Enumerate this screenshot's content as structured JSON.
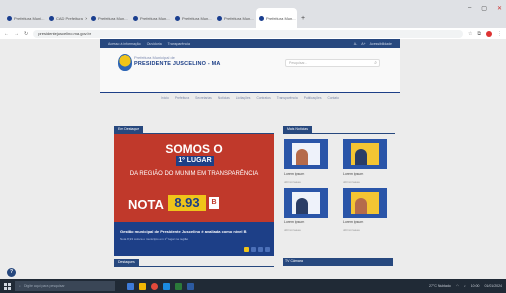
{
  "browser": {
    "tabs": [
      {
        "label": "Prefeitura Muni..."
      },
      {
        "label": "CAD Prefeitura"
      },
      {
        "label": "Prefeitura Mun..."
      },
      {
        "label": "Prefeitura Mun..."
      },
      {
        "label": "Prefeitura Mun..."
      },
      {
        "label": "Prefeitura Mun..."
      },
      {
        "label": "Prefeitura Mun..."
      }
    ],
    "new_tab": "+",
    "window_controls": {
      "minimize": "–",
      "maximize": "▢",
      "close": "✕"
    },
    "url": "presidentejuscelino.ma.gov.br",
    "back": "←",
    "forward": "→",
    "reload": "↻"
  },
  "site": {
    "topbar_left": [
      "Acesso à informação",
      "Ouvidoria",
      "Transparência"
    ],
    "topbar_right": [
      "A-",
      "A+",
      "Acessibilidade"
    ],
    "brand_top": "Prefeitura Municipal de",
    "brand_main": "PRESIDENTE JUSCELINO - MA",
    "search_placeholder": "Pesquisar...",
    "menu": [
      "Início",
      "Prefeitura",
      "Secretarias",
      "Notícias",
      "Licitações",
      "Contratos",
      "Transparência",
      "Publicações",
      "Contato"
    ]
  },
  "featured": {
    "section_title": "Em Destaque",
    "hero_line1": "SOMOS O",
    "hero_line2": "1º LUGAR",
    "hero_line3": "DA REGIÃO DO MUNIM EM TRANSPARÊNCIA",
    "nota_label": "NOTA",
    "nota_value": "8.93",
    "grade": "B",
    "caption_title": "Gestão municipal de Presidente Juscelino é avaliada como nível B",
    "caption_sub": "Nota 8,93 coloca o município em 1º lugar na região"
  },
  "news": {
    "section_title": "Mais Notícias",
    "items": [
      {
        "title": "Lorem ipsum",
        "date": "dd/mm/aaaa"
      },
      {
        "title": "Lorem ipsum",
        "date": "dd/mm/aaaa"
      },
      {
        "title": "Lorem ipsum",
        "date": "dd/mm/aaaa"
      },
      {
        "title": "Lorem ipsum",
        "date": "dd/mm/aaaa"
      }
    ]
  },
  "bottom": {
    "left_title": "Destaques",
    "tv_title": "TV Câmara"
  },
  "help_icon": "?",
  "taskbar": {
    "search_placeholder": "Digite aqui para pesquisar",
    "weather": "27°C Nublado",
    "time": "10:00",
    "date": "01/01/2024"
  }
}
